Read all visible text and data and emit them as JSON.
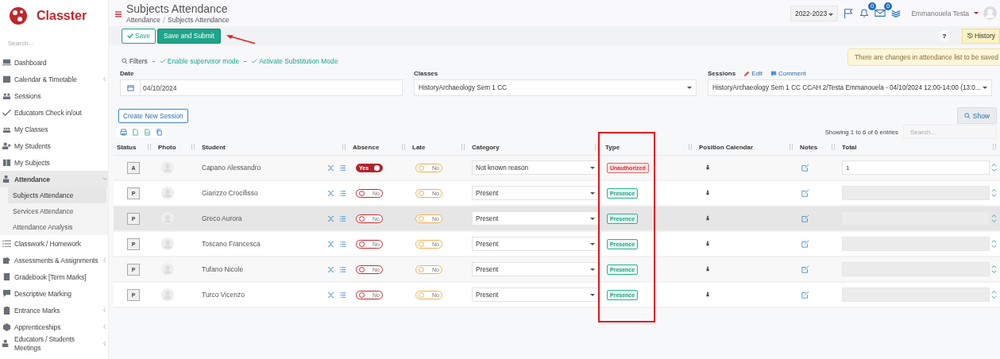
{
  "brand": {
    "name": "Classter"
  },
  "sidebar": {
    "search": {
      "placeholder": "Search..."
    },
    "items": [
      {
        "label": "Dashboard",
        "has_submenu": false,
        "expanded": false
      },
      {
        "label": "Calendar & Timetable",
        "has_submenu": true,
        "expanded": false
      },
      {
        "label": "Sessions",
        "has_submenu": false,
        "expanded": false
      },
      {
        "label": "Educators Check in/out",
        "has_submenu": false,
        "expanded": false
      },
      {
        "label": "My Classes",
        "has_submenu": false,
        "expanded": false
      },
      {
        "label": "My Students",
        "has_submenu": false,
        "expanded": false
      },
      {
        "label": "My Subjects",
        "has_submenu": false,
        "expanded": false
      },
      {
        "label": "Attendance",
        "has_submenu": true,
        "expanded": true,
        "children": [
          {
            "label": "Subjects Attendance",
            "selected": true
          },
          {
            "label": "Services Attendance",
            "selected": false
          },
          {
            "label": "Attendance Analysis",
            "selected": false
          }
        ]
      },
      {
        "label": "Classwork / Homework",
        "has_submenu": false,
        "expanded": false
      },
      {
        "label": "Assessments & Assignments",
        "has_submenu": true,
        "expanded": false
      },
      {
        "label": "Gradebook [Term Marks]",
        "has_submenu": false,
        "expanded": false
      },
      {
        "label": "Descriptive Marking",
        "has_submenu": false,
        "expanded": false
      },
      {
        "label": "Entrance Marks",
        "has_submenu": true,
        "expanded": false
      },
      {
        "label": "Apprenticeships",
        "has_submenu": true,
        "expanded": false
      },
      {
        "label": "Educators / Students Meetings",
        "has_submenu": true,
        "expanded": false
      }
    ]
  },
  "header": {
    "title": "Subjects Attendance",
    "breadcrumb": [
      "Attendance",
      "Subjects Attendance"
    ],
    "year": "2022-2023",
    "notifications": "0",
    "messages": "0",
    "user": "Emmanouela Testa"
  },
  "toolbar": {
    "save": "Save",
    "submit": "Save and Submit",
    "help": "?",
    "history": "History",
    "notice": "There are changes in attendance list to be saved"
  },
  "filters": {
    "label": "Filters",
    "links": [
      "Enable supervisor mode",
      "Activate Substitution Mode"
    ]
  },
  "form": {
    "date": {
      "label": "Date",
      "value": "04/10/2024"
    },
    "classes": {
      "label": "Classes",
      "value": "HistoryArchaeology Sem 1 CC"
    },
    "sessions": {
      "label": "Sessions",
      "edit": "Edit",
      "comment": "Comment",
      "value": "HistoryArchaeology Sem 1 CC CCAH 2/Testa Emmanouela - 04/10/2024 12:00-14:00 (13:0..."
    },
    "create": "Create New Session",
    "show": "Show"
  },
  "table": {
    "info": "Showing 1 to 6 of 6 entries",
    "search": {
      "placeholder": "Search..."
    },
    "columns": [
      "Status",
      "Photo",
      "Student",
      "Absence",
      "Late",
      "Category",
      "Type",
      "Position Calendar",
      "Notes",
      "Total"
    ],
    "rows": [
      {
        "status": "A",
        "student": "Capano Alessandro",
        "absence": {
          "on": true,
          "label": "Yes"
        },
        "late": {
          "on": false,
          "label": "No"
        },
        "category": "Not known reason",
        "type": {
          "label": "Unauthorized",
          "kind": "unauthorized"
        },
        "total": "1",
        "editable": true,
        "highlighted": false
      },
      {
        "status": "P",
        "student": "Giarizzo Crocifisso",
        "absence": {
          "on": false,
          "label": "No"
        },
        "late": {
          "on": false,
          "label": "No"
        },
        "category": "Present",
        "type": {
          "label": "Presence",
          "kind": "presence"
        },
        "editable": false,
        "highlighted": false
      },
      {
        "status": "P",
        "student": "Greco Aurora",
        "absence": {
          "on": false,
          "label": "No"
        },
        "late": {
          "on": false,
          "label": "No"
        },
        "category": "Present",
        "type": {
          "label": "Presence",
          "kind": "presence"
        },
        "editable": false,
        "highlighted": true
      },
      {
        "status": "P",
        "student": "Toscano Francesca",
        "absence": {
          "on": false,
          "label": "No"
        },
        "late": {
          "on": false,
          "label": "No"
        },
        "category": "Present",
        "type": {
          "label": "Presence",
          "kind": "presence"
        },
        "editable": false,
        "highlighted": false
      },
      {
        "status": "P",
        "student": "Tufano Nicole",
        "absence": {
          "on": false,
          "label": "No"
        },
        "late": {
          "on": false,
          "label": "No"
        },
        "category": "Present",
        "type": {
          "label": "Presence",
          "kind": "presence"
        },
        "editable": false,
        "highlighted": false
      },
      {
        "status": "P",
        "student": "Turco Vicenzo",
        "absence": {
          "on": false,
          "label": "No"
        },
        "late": {
          "on": false,
          "label": "No"
        },
        "category": "Present",
        "type": {
          "label": "Presence",
          "kind": "presence"
        },
        "editable": false,
        "highlighted": false
      }
    ]
  }
}
